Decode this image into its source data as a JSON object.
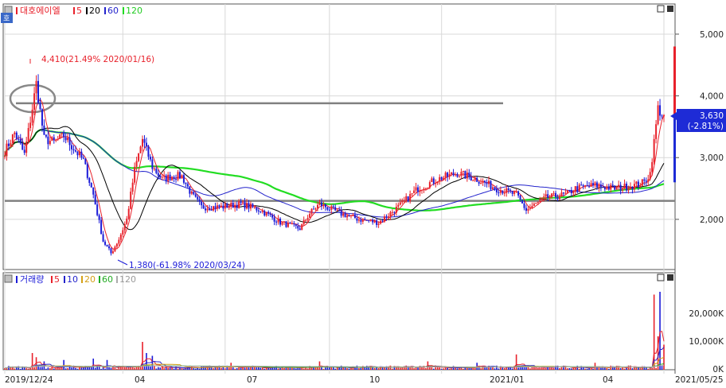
{
  "colors": {
    "up": "#e8212b",
    "down": "#1b1bd8",
    "ma5": "#e8212b",
    "ma20": "#000000",
    "ma60": "#2323cc",
    "ma120": "#22dd22",
    "vol_ma10": "#2323cc",
    "vol_ma20": "#d4a017",
    "vol_ma60": "#22aa22",
    "vol_ma120": "#aaaaaa",
    "grid": "#d8d8d8",
    "hline": "#808080",
    "price_tag": "#1e2bd6"
  },
  "chart_data": [
    {
      "type": "candlestick",
      "title": "대호에이엘",
      "ma_periods": [
        "5",
        "20",
        "60",
        "120"
      ],
      "y_ticks": [
        2000,
        3000,
        4000,
        5000
      ],
      "y_tick_labels": [
        "2,000",
        "3,000",
        "4,000",
        "5,000"
      ],
      "ylim": [
        1200,
        5450
      ],
      "x_ticks": [
        "2019/12/24",
        "04",
        "07",
        "10",
        "2021/01",
        "04",
        "2021/05/25"
      ],
      "annotations": {
        "high": "4,410(21.49% 2020/01/16)",
        "low": "1,380(-61.98% 2020/03/24)"
      },
      "current_price": "3,630",
      "current_change": "(-2.81%)",
      "horizontal_lines": [
        3880,
        2300
      ],
      "price_path": [
        [
          0,
          3100
        ],
        [
          5,
          3400
        ],
        [
          10,
          3050
        ],
        [
          14,
          3800
        ],
        [
          16,
          4200
        ],
        [
          20,
          3300
        ],
        [
          25,
          3250
        ],
        [
          30,
          3350
        ],
        [
          35,
          3150
        ],
        [
          40,
          2950
        ],
        [
          45,
          2400
        ],
        [
          50,
          1650
        ],
        [
          54,
          1450
        ],
        [
          58,
          1680
        ],
        [
          62,
          2000
        ],
        [
          66,
          2800
        ],
        [
          70,
          3300
        ],
        [
          75,
          2850
        ],
        [
          80,
          2650
        ],
        [
          85,
          2700
        ],
        [
          90,
          2700
        ],
        [
          95,
          2400
        ],
        [
          100,
          2200
        ],
        [
          110,
          2200
        ],
        [
          120,
          2250
        ],
        [
          130,
          2150
        ],
        [
          140,
          1950
        ],
        [
          150,
          1850
        ],
        [
          155,
          2100
        ],
        [
          160,
          2250
        ],
        [
          170,
          2100
        ],
        [
          180,
          2000
        ],
        [
          190,
          1950
        ],
        [
          200,
          2200
        ],
        [
          210,
          2500
        ],
        [
          220,
          2650
        ],
        [
          230,
          2750
        ],
        [
          240,
          2650
        ],
        [
          250,
          2500
        ],
        [
          260,
          2400
        ],
        [
          265,
          2150
        ],
        [
          275,
          2350
        ],
        [
          285,
          2400
        ],
        [
          290,
          2500
        ],
        [
          300,
          2550
        ],
        [
          310,
          2500
        ],
        [
          320,
          2550
        ],
        [
          325,
          2600
        ],
        [
          328,
          2750
        ],
        [
          330,
          3250
        ],
        [
          332,
          3800
        ],
        [
          335,
          3650
        ]
      ],
      "volume": {
        "title": "거래량",
        "ma_periods": [
          "5",
          "10",
          "20",
          "60",
          "120"
        ],
        "y_ticks": [
          0,
          10000,
          20000
        ],
        "y_tick_labels": [
          "0K",
          "10,000K",
          "20,000K"
        ],
        "ylim": [
          0,
          30000
        ],
        "spikes": [
          [
            14,
            6000
          ],
          [
            16,
            4500
          ],
          [
            20,
            3000
          ],
          [
            30,
            3500
          ],
          [
            45,
            4000
          ],
          [
            52,
            3500
          ],
          [
            70,
            10000
          ],
          [
            72,
            6000
          ],
          [
            75,
            5000
          ],
          [
            115,
            2500
          ],
          [
            160,
            3000
          ],
          [
            215,
            3000
          ],
          [
            240,
            2500
          ],
          [
            260,
            5500
          ],
          [
            300,
            2500
          ],
          [
            330,
            27000
          ],
          [
            332,
            12000
          ],
          [
            333,
            28000
          ],
          [
            335,
            9000
          ]
        ]
      }
    }
  ]
}
